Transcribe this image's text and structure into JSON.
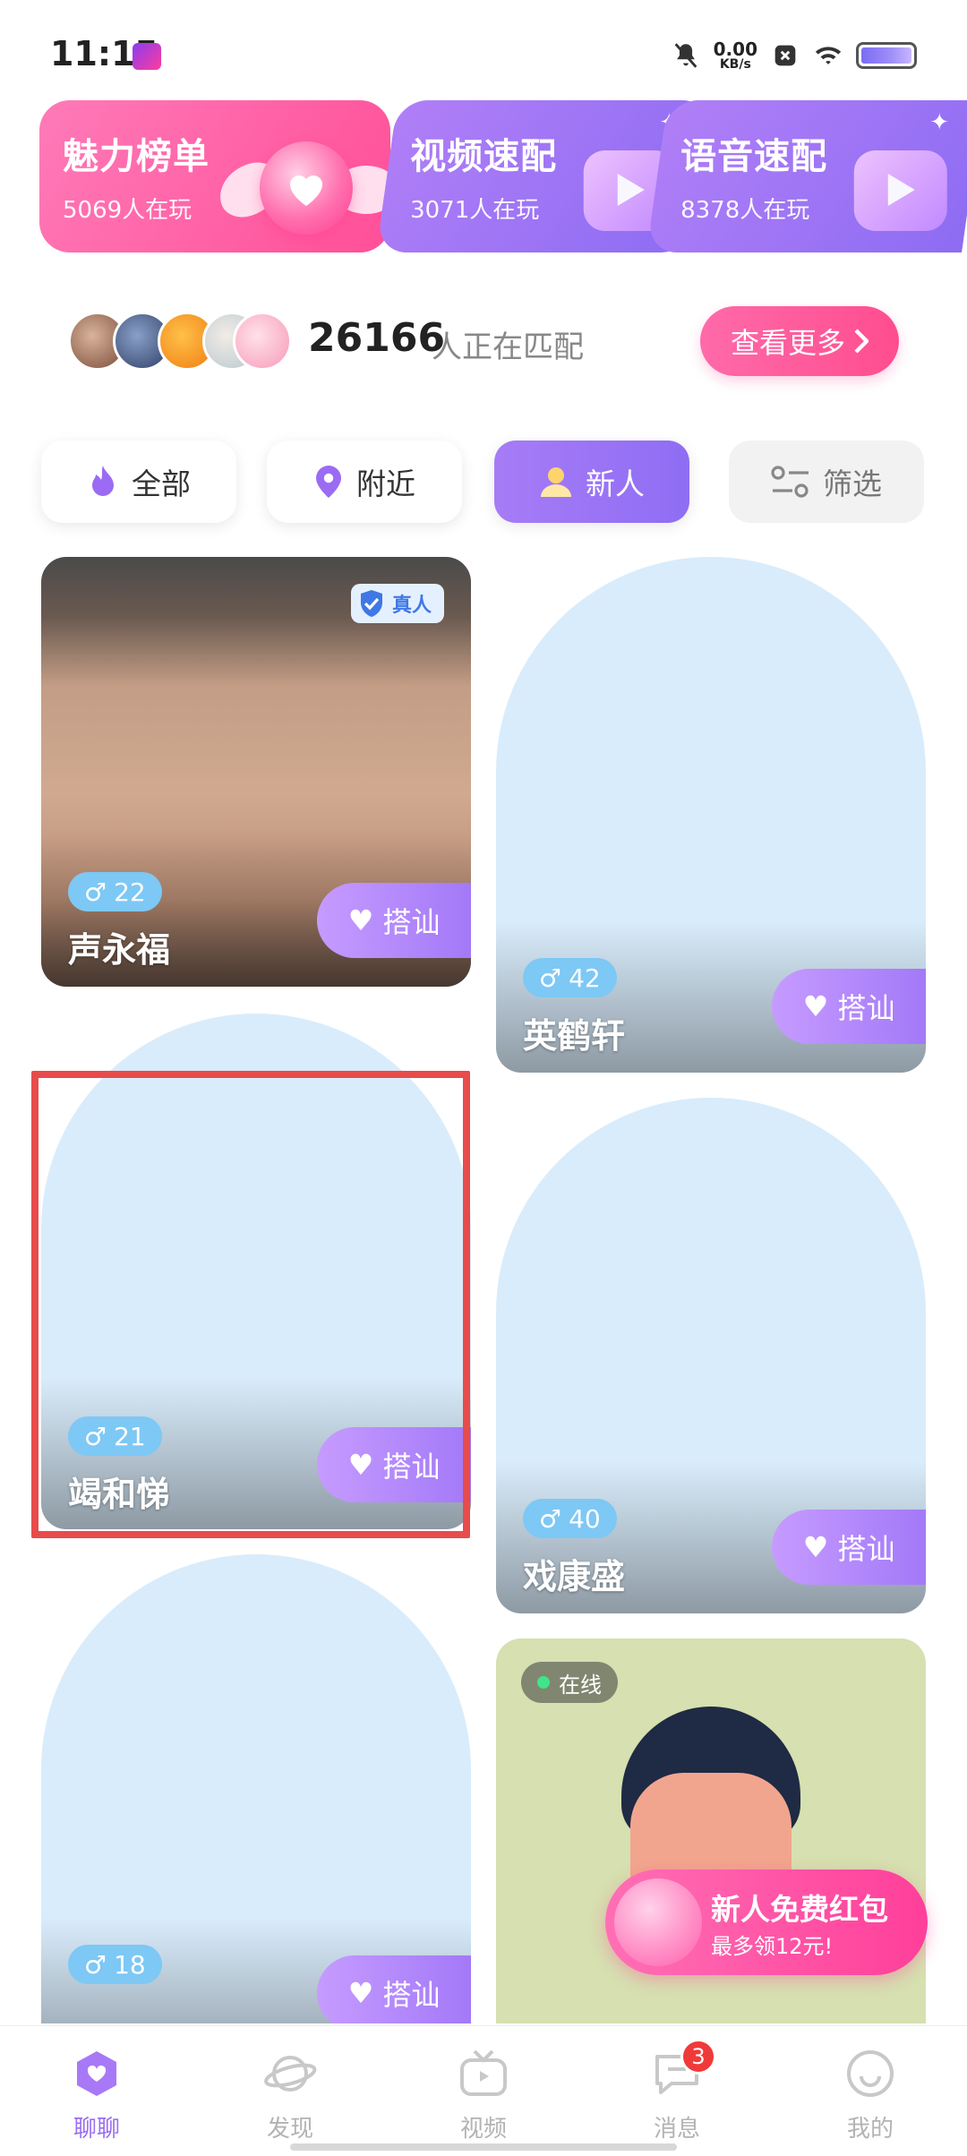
{
  "status_bar": {
    "time": "11:15",
    "net_speed_value": "0.00",
    "net_speed_unit": "KB/s"
  },
  "banners": [
    {
      "title": "魅力榜单",
      "sub": "5069人在玩"
    },
    {
      "title": "视频速配",
      "sub": "3071人在玩"
    },
    {
      "title": "语音速配",
      "sub": "8378人在玩"
    }
  ],
  "matching": {
    "count": "26166",
    "label": "人正在匹配",
    "more_label": "查看更多"
  },
  "tabs": [
    {
      "label": "全部"
    },
    {
      "label": "附近"
    },
    {
      "label": "新人"
    },
    {
      "label": "筛选"
    }
  ],
  "cards": [
    {
      "age": "22",
      "name": "声永福",
      "chat_label": "搭讪",
      "verified_label": "真人"
    },
    {
      "age": "42",
      "name": "英鹤轩",
      "chat_label": "搭讪"
    },
    {
      "age": "21",
      "name": "竭和悌",
      "chat_label": "搭讪"
    },
    {
      "age": "40",
      "name": "戏康盛",
      "chat_label": "搭讪"
    },
    {
      "age": "18",
      "name": "",
      "chat_label": "搭讪"
    },
    {
      "online_label": "在线"
    }
  ],
  "promo": {
    "title": "新人免费红包",
    "sub": "最多领12元!"
  },
  "nav": [
    {
      "label": "聊聊"
    },
    {
      "label": "发现"
    },
    {
      "label": "视频"
    },
    {
      "label": "消息",
      "badge": "3"
    },
    {
      "label": "我的"
    }
  ],
  "colors": {
    "accent": "#9a6ef2",
    "pink": "#ff4f98",
    "tag_blue": "#7dc8f5",
    "highlight": "#e84b4b"
  }
}
